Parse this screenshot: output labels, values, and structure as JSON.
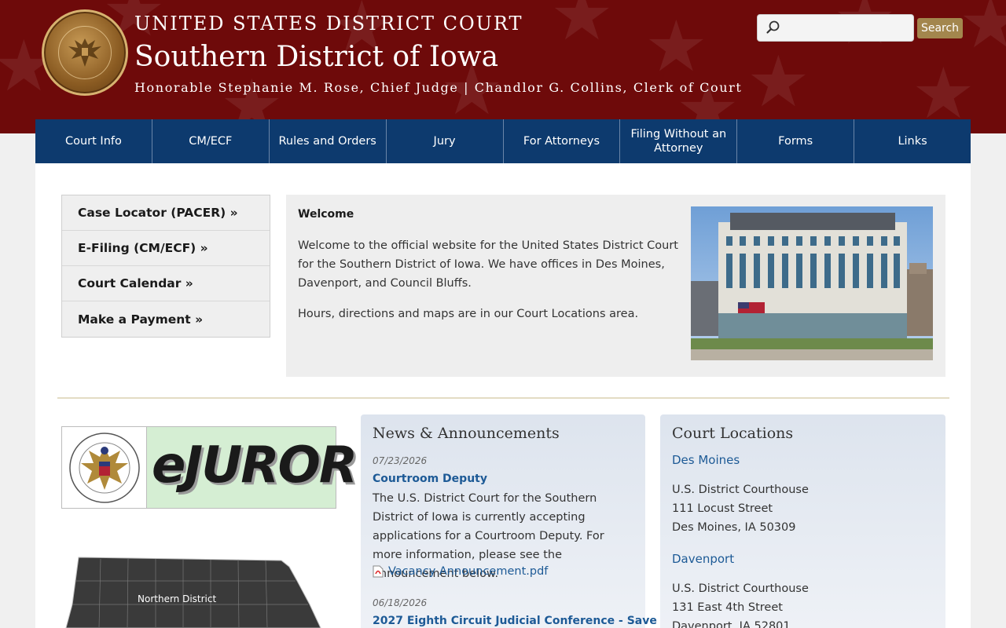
{
  "header": {
    "line1": "UNITED STATES DISTRICT COURT",
    "line2": "Southern District of Iowa",
    "line3": "Honorable Stephanie M. Rose, Chief Judge | Chandlor G. Collins, Clerk of Court",
    "seal_icon": "court-seal-icon",
    "accent_color": "#6e0a0a"
  },
  "search": {
    "placeholder": "",
    "button_label": "Search"
  },
  "nav": {
    "items": [
      {
        "label": "Court Info"
      },
      {
        "label": "CM/ECF"
      },
      {
        "label": "Rules and Orders"
      },
      {
        "label": "Jury"
      },
      {
        "label": "For Attorneys"
      },
      {
        "label": "Filing Without an Attorney"
      },
      {
        "label": "Forms"
      },
      {
        "label": "Links"
      }
    ],
    "color": "#0d3a6e"
  },
  "quick_links": [
    {
      "label": "Case Locator (PACER) »"
    },
    {
      "label": "E-Filing (CM/ECF) »"
    },
    {
      "label": "Court Calendar »"
    },
    {
      "label": "Make a Payment »"
    }
  ],
  "welcome": {
    "title": "Welcome",
    "paragraph1": "Welcome to the official website for the United States District Court for the Southern District of Iowa. We have offices in Des Moines, Davenport, and Council Bluffs.",
    "paragraph2": "Hours, directions and maps are in our Court Locations area."
  },
  "ejuror": {
    "label": "eJUROR"
  },
  "map": {
    "region_label": "Northern District"
  },
  "news": {
    "title": "News & Announcements",
    "items": [
      {
        "date": "07/23/2026",
        "title": "Courtroom Deputy",
        "body": "The U.S. District Court for the Southern District of Iowa is currently accepting applications for a Courtroom Deputy. For more information, please see the announcement below.",
        "attachment": "Vacancy Announcement.pdf"
      },
      {
        "date": "06/18/2026",
        "title": "2027 Eighth Circuit Judicial Conference - Save"
      }
    ]
  },
  "locations": {
    "title": "Court Locations",
    "offices": [
      {
        "city": "Des Moines",
        "building": "U.S. District Courthouse",
        "street": "111 Locust Street",
        "citystatezip": "Des Moines, IA 50309"
      },
      {
        "city": "Davenport",
        "building": "U.S. District Courthouse",
        "street": "131 East 4th Street",
        "citystatezip": "Davenport, IA 52801"
      }
    ]
  }
}
